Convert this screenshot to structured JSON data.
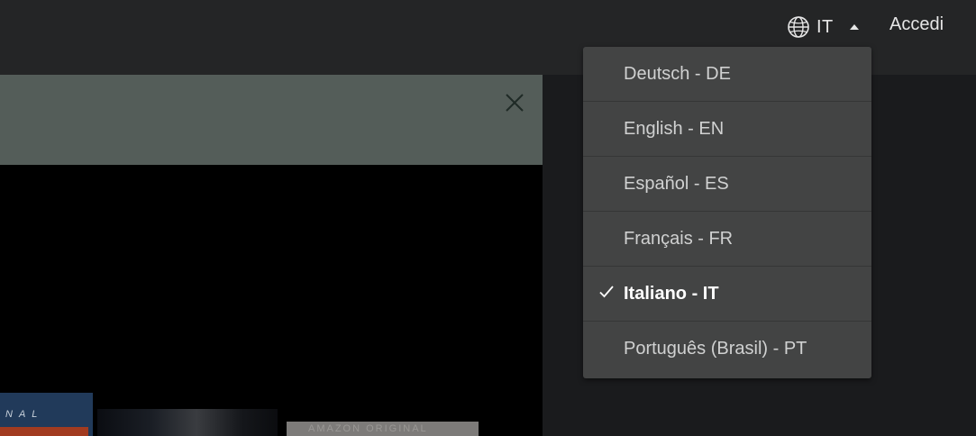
{
  "header": {
    "language_code": "IT",
    "signin_label": "Accedi",
    "globe_icon": "globe-icon",
    "caret_icon": "caret-up-icon"
  },
  "language_menu": {
    "items": [
      {
        "label": "Deutsch - DE",
        "selected": false
      },
      {
        "label": "English - EN",
        "selected": false
      },
      {
        "label": "Español - ES",
        "selected": false
      },
      {
        "label": "Français - FR",
        "selected": false
      },
      {
        "label": "Italiano - IT",
        "selected": true
      },
      {
        "label": "Português (Brasil) - PT",
        "selected": false
      }
    ],
    "check_icon": "checkmark-icon"
  },
  "banner": {
    "close_icon": "close-icon"
  },
  "thumbnails": {
    "first_text": "NAL",
    "third_text": "AMAZON ORIGINAL"
  },
  "colors": {
    "topbar": "#242526",
    "banner": "#545d59",
    "menu": "#434444",
    "background": "#1a1b1d"
  }
}
